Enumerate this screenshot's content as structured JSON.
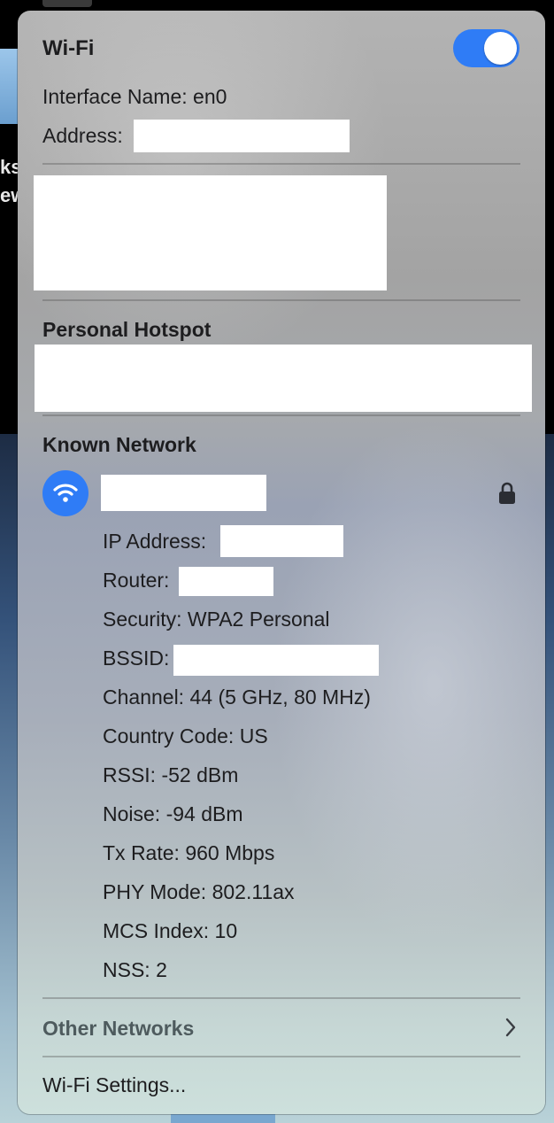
{
  "background": {
    "partial_text_1": "ks",
    "partial_text_2": "ew"
  },
  "header": {
    "title": "Wi-Fi",
    "toggle_on": true
  },
  "interface": {
    "name_label": "Interface Name:",
    "name_value": "en0",
    "address_label": "Address:"
  },
  "hotspot": {
    "heading": "Personal Hotspot"
  },
  "known": {
    "heading": "Known Network",
    "icon": "wifi-icon",
    "lock_icon": "lock-icon",
    "details": [
      {
        "label": "IP Address:",
        "value": ""
      },
      {
        "label": "Router:",
        "value": ""
      },
      {
        "label": "Security:",
        "value": "WPA2 Personal"
      },
      {
        "label": "BSSID:",
        "value": ""
      },
      {
        "label": "Channel:",
        "value": "44 (5 GHz, 80 MHz)"
      },
      {
        "label": "Country Code:",
        "value": "US"
      },
      {
        "label": "RSSI:",
        "value": "-52 dBm"
      },
      {
        "label": "Noise:",
        "value": "-94 dBm"
      },
      {
        "label": "Tx Rate:",
        "value": "960 Mbps"
      },
      {
        "label": "PHY Mode:",
        "value": "802.11ax"
      },
      {
        "label": "MCS Index:",
        "value": "10"
      },
      {
        "label": "NSS:",
        "value": "2"
      }
    ]
  },
  "footer": {
    "other_networks": "Other Networks",
    "settings": "Wi-Fi Settings..."
  },
  "colors": {
    "accent": "#2f7cf6"
  }
}
